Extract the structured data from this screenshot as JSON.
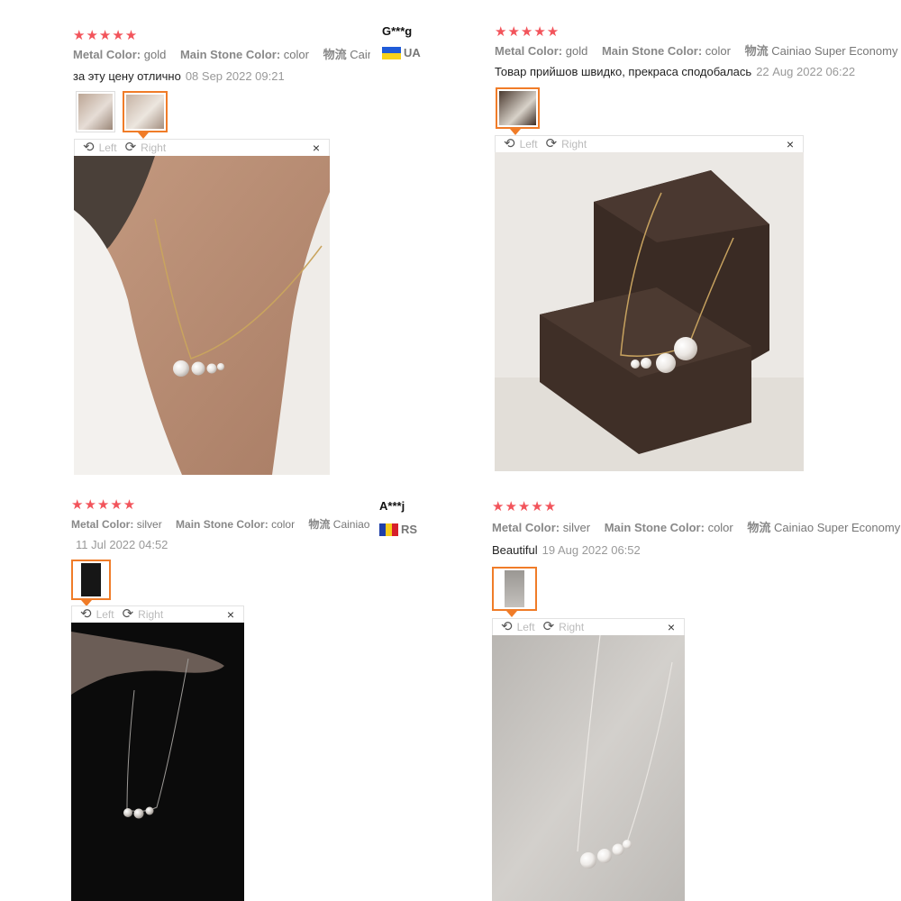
{
  "stars": "★★★★★",
  "toolbar": {
    "left": "Left",
    "right": "Right",
    "close": "×",
    "rotate_left_icon": "⟲",
    "rotate_right_icon": "⟳"
  },
  "reviews": [
    {
      "user": "G***g",
      "country": "UA",
      "metal_label": "Metal Color:",
      "metal": "gold",
      "stone_label": "Main Stone Color:",
      "stone": "color",
      "ship_label": "物流",
      "ship": "Caini",
      "comment": "за эту цену отлично",
      "date": "08 Sep 2022 09:21"
    },
    {
      "user": "",
      "country": "",
      "metal_label": "Metal Color:",
      "metal": "gold",
      "stone_label": "Main Stone Color:",
      "stone": "color",
      "ship_label": "物流",
      "ship": "Cainiao Super Economy",
      "comment": "Товар прийшов швидко, прекраса сподобалась",
      "date": "22 Aug 2022 06:22"
    },
    {
      "user": "A***j",
      "country": "RS",
      "metal_label": "Metal Color:",
      "metal": "silver",
      "stone_label": "Main Stone Color:",
      "stone": "color",
      "ship_label": "物流",
      "ship": "Cainiao Ex",
      "comment": "",
      "date": "11 Jul 2022 04:52"
    },
    {
      "user": "",
      "country": "",
      "metal_label": "Metal Color:",
      "metal": "silver",
      "stone_label": "Main Stone Color:",
      "stone": "color",
      "ship_label": "物流",
      "ship": "Cainiao Super Economy",
      "comment": "Beautiful",
      "date": "19 Aug 2022 06:52"
    }
  ],
  "colors": {
    "star": "#f2545b",
    "selected_border": "#f07c28",
    "muted": "#777777"
  }
}
